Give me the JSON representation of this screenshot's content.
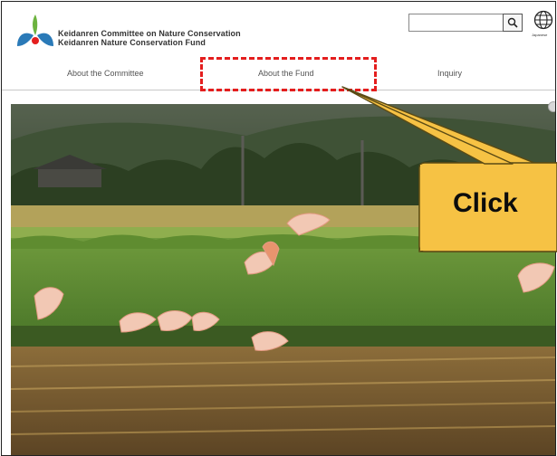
{
  "header": {
    "org_line1": "Keidanren Committee on Nature Conservation",
    "org_line2": "Keidanren Nature Conservation Fund",
    "language_label": "Japanese"
  },
  "search": {
    "placeholder": "",
    "value": ""
  },
  "nav": {
    "items": [
      {
        "label": "About the Committee"
      },
      {
        "label": "About the Fund"
      },
      {
        "label": "Inquiry"
      }
    ]
  },
  "callout": {
    "label": "Click"
  },
  "colors": {
    "highlight": "#e41e1e",
    "callout_fill": "#f6c244",
    "logo_blue": "#2a7ab8",
    "logo_green": "#6cb33f"
  },
  "icons": [
    "logo-icon",
    "search-icon",
    "globe-icon"
  ]
}
